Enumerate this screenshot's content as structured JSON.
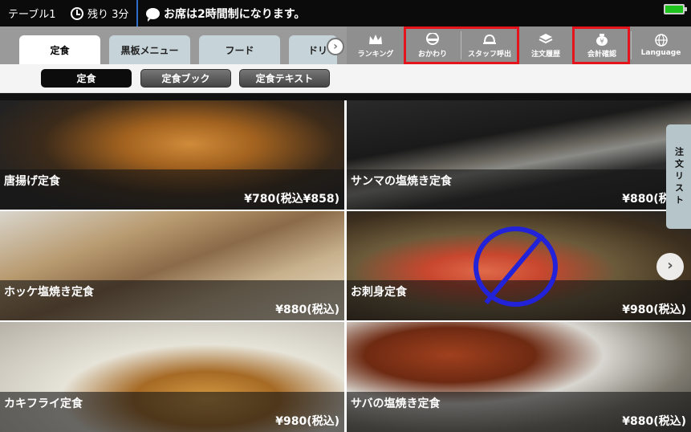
{
  "header": {
    "table": "テーブル1",
    "remaining": "残り 3分",
    "notice": "お席は2時間制になります。"
  },
  "tabs": [
    {
      "label": "定食",
      "active": true
    },
    {
      "label": "黒板メニュー",
      "active": false
    },
    {
      "label": "フード",
      "active": false
    },
    {
      "label": "ドリ",
      "active": false
    }
  ],
  "actions": [
    {
      "label": "ランキング",
      "icon": "crown-icon"
    },
    {
      "label": "おかわり",
      "icon": "rice-bowl-icon"
    },
    {
      "label": "スタッフ呼出",
      "icon": "bell-icon"
    },
    {
      "label": "注文履歴",
      "icon": "history-icon"
    },
    {
      "label": "会計確認",
      "icon": "money-bag-icon"
    },
    {
      "label": "Language",
      "icon": "globe-icon"
    }
  ],
  "subtabs": [
    {
      "label": "定食",
      "active": true
    },
    {
      "label": "定食ブック",
      "active": false
    },
    {
      "label": "定食テキスト",
      "active": false
    }
  ],
  "menu": [
    {
      "name": "唐揚げ定食",
      "price": "¥780(税込¥858)"
    },
    {
      "name": "サンマの塩焼き定食",
      "price": "¥880(税込)"
    },
    {
      "name": "ホッケ塩焼き定食",
      "price": "¥880(税込)"
    },
    {
      "name": "お刺身定食",
      "price": "¥980(税込)"
    },
    {
      "name": "カキフライ定食",
      "price": "¥980(税込)"
    },
    {
      "name": "サバの塩焼き定食",
      "price": "¥880(税込)"
    }
  ],
  "side_tab": "注文リスト",
  "colors": {
    "highlight": "#e3141c",
    "marker": "#2222d8",
    "battery": "#1ec31e"
  }
}
